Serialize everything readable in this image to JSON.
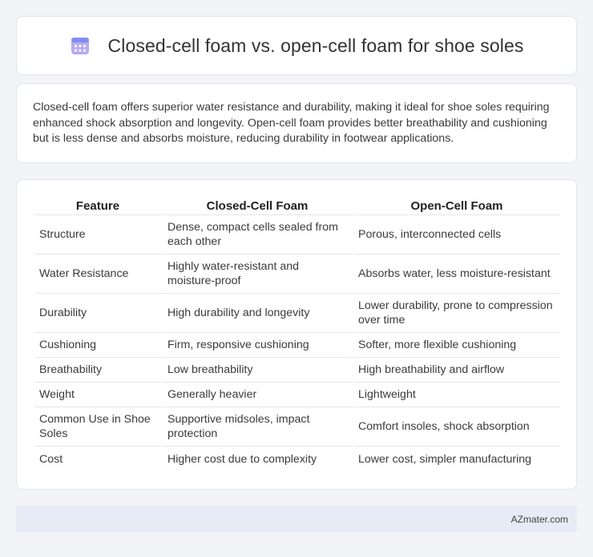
{
  "header": {
    "title": "Closed-cell foam vs. open-cell foam for shoe soles",
    "icon": "calendar-icon",
    "icon_color": "#8f7ee6"
  },
  "summary": {
    "text": "Closed-cell foam offers superior water resistance and durability, making it ideal for shoe soles requiring enhanced shock absorption and longevity. Open-cell foam provides better breathability and cushioning but is less dense and absorbs moisture, reducing durability in footwear applications."
  },
  "table": {
    "headers": [
      "Feature",
      "Closed-Cell Foam",
      "Open-Cell Foam"
    ],
    "rows": [
      [
        "Structure",
        "Dense, compact cells sealed from each other",
        "Porous, interconnected cells"
      ],
      [
        "Water Resistance",
        "Highly water-resistant and moisture-proof",
        "Absorbs water, less moisture-resistant"
      ],
      [
        "Durability",
        "High durability and longevity",
        "Lower durability, prone to compression over time"
      ],
      [
        "Cushioning",
        "Firm, responsive cushioning",
        "Softer, more flexible cushioning"
      ],
      [
        "Breathability",
        "Low breathability",
        "High breathability and airflow"
      ],
      [
        "Weight",
        "Generally heavier",
        "Lightweight"
      ],
      [
        "Common Use in Shoe Soles",
        "Supportive midsoles, impact protection",
        "Comfort insoles, shock absorption"
      ],
      [
        "Cost",
        "Higher cost due to complexity",
        "Lower cost, simpler manufacturing"
      ]
    ]
  },
  "footer": {
    "brand": "AZmater.com"
  }
}
